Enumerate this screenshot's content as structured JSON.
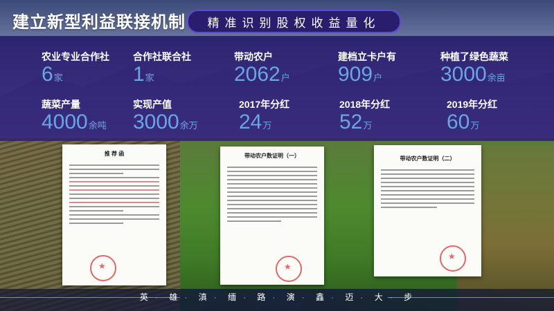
{
  "header": {
    "title": "建立新型利益联接机制",
    "subtitle": "精准识别股权收益量化"
  },
  "stats": [
    {
      "label": "农业专业合作社",
      "value": "6",
      "unit": "家"
    },
    {
      "label": "合作社联合社",
      "value": "1",
      "unit": "家"
    },
    {
      "label": "带动农户",
      "value": "2062",
      "unit": "户"
    },
    {
      "label": "建档立卡户有",
      "value": "909",
      "unit": "户"
    },
    {
      "label": "种植了绿色蔬菜",
      "value": "3000",
      "unit": "余亩"
    },
    {
      "label": "蔬菜产量",
      "value": "4000",
      "unit": "余吨"
    },
    {
      "label": "实现产值",
      "value": "3000",
      "unit": "余万"
    },
    {
      "label": "2017年分红",
      "value": "24",
      "unit": "万"
    },
    {
      "label": "2018年分红",
      "value": "52",
      "unit": "万"
    },
    {
      "label": "2019年分红",
      "value": "60",
      "unit": "万"
    }
  ],
  "documents": [
    {
      "title": "推 荐 函"
    },
    {
      "title": "带动农户数证明（一）"
    },
    {
      "title": "带动农户数证明（二）"
    }
  ],
  "footer": {
    "chars": [
      "英",
      "雄",
      "滇",
      "缅",
      "路",
      "演",
      "鑫",
      "迈",
      "大",
      "步"
    ]
  },
  "colors": {
    "banner": "#30208a",
    "value_blue": "#6aa6e6",
    "pill_border": "#5a4bd0"
  }
}
